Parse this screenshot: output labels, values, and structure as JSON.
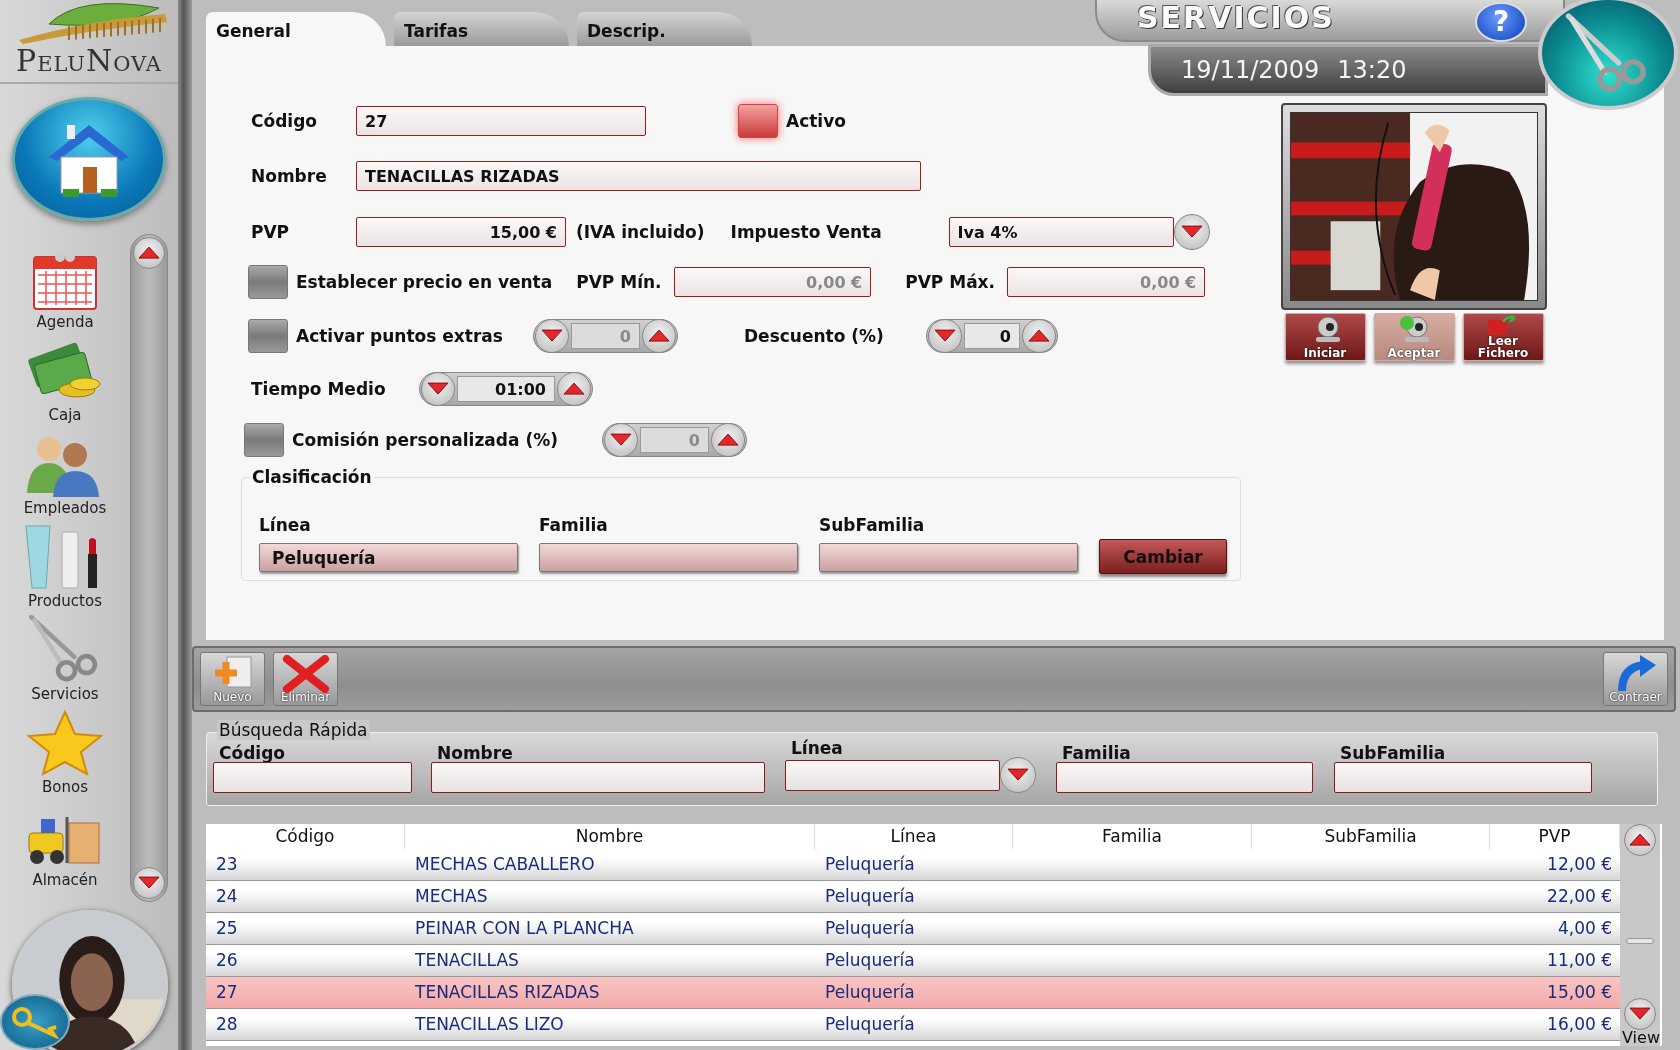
{
  "sidebar": {
    "logo": "PeluNova",
    "nav": [
      {
        "label": "Agenda"
      },
      {
        "label": "Caja"
      },
      {
        "label": "Empleados"
      },
      {
        "label": "Productos"
      },
      {
        "label": "Servicios"
      },
      {
        "label": "Bonos"
      },
      {
        "label": "Almacén"
      }
    ]
  },
  "tabs": [
    {
      "label": "General",
      "selected": true
    },
    {
      "label": "Tarifas",
      "selected": false
    },
    {
      "label": "Descrip.",
      "selected": false
    }
  ],
  "header": {
    "title": "SERVICIOS",
    "help": "?",
    "date": "19/11/2009",
    "time": "13:20"
  },
  "form": {
    "codigo": {
      "label": "Código",
      "value": "27"
    },
    "activo": {
      "label": "Activo",
      "checked": true
    },
    "nombre": {
      "label": "Nombre",
      "value": "TENACILLAS RIZADAS"
    },
    "pvp": {
      "label": "PVP",
      "value": "15,00 €",
      "note": "(IVA incluido)"
    },
    "impuesto": {
      "label": "Impuesto Venta",
      "value": "Iva 4%"
    },
    "establecer": {
      "label": "Establecer precio en venta",
      "checked": false
    },
    "pvp_min": {
      "label": "PVP Mín.",
      "value": "0,00 €",
      "disabled": true
    },
    "pvp_max": {
      "label": "PVP Máx.",
      "value": "0,00 €",
      "disabled": true
    },
    "puntos": {
      "label": "Activar puntos extras",
      "checked": false,
      "value": "0",
      "disabled": true
    },
    "descuento": {
      "label": "Descuento (%)",
      "value": "0",
      "disabled": false
    },
    "tiempo": {
      "label": "Tiempo Medio",
      "value": "01:00",
      "disabled": false
    },
    "comision": {
      "label": "Comisión personalizada (%)",
      "checked": false,
      "value": "0",
      "disabled": true
    },
    "clasificacion": {
      "title": "Clasificación",
      "fields": [
        {
          "label": "Línea",
          "value": "Peluquería"
        },
        {
          "label": "Familia"
        },
        {
          "label": "SubFamilia"
        }
      ],
      "button": "Cambiar"
    }
  },
  "photo": {
    "kind": "picture",
    "buttons": [
      {
        "label": "Iniciar",
        "disabled": false
      },
      {
        "label": "Aceptar",
        "disabled": true
      },
      {
        "label": "Leer Fichero",
        "disabled": false
      }
    ]
  },
  "toolbar": {
    "buttons": [
      {
        "label": "Nuevo"
      },
      {
        "label": "Eliminar"
      }
    ],
    "collapse": "Contraer"
  },
  "search": {
    "title": "Búsqueda Rápida",
    "fields": [
      {
        "label": "Código",
        "kind": "text"
      },
      {
        "label": "Nombre",
        "kind": "text"
      },
      {
        "label": "Línea",
        "kind": "dropdown"
      },
      {
        "label": "Familia",
        "kind": "text"
      },
      {
        "label": "SubFamilia",
        "kind": "text"
      }
    ]
  },
  "table": {
    "columns": [
      "Código",
      "Nombre",
      "Línea",
      "Familia",
      "SubFamilia",
      "PVP"
    ],
    "rows": [
      {
        "cells": [
          "23",
          "MECHAS CABALLERO",
          "Peluquería",
          "",
          "",
          "12,00 €"
        ],
        "selected": false
      },
      {
        "cells": [
          "24",
          "MECHAS",
          "Peluquería",
          "",
          "",
          "22,00 €"
        ],
        "selected": false
      },
      {
        "cells": [
          "25",
          "PEINAR CON LA PLANCHA",
          "Peluquería",
          "",
          "",
          "4,00 €"
        ],
        "selected": false
      },
      {
        "cells": [
          "26",
          "TENACILLAS",
          "Peluquería",
          "",
          "",
          "11,00 €"
        ],
        "selected": false
      },
      {
        "cells": [
          "27",
          "TENACILLAS RIZADAS",
          "Peluquería",
          "",
          "",
          "15,00 €"
        ],
        "selected": true
      },
      {
        "cells": [
          "28",
          "TENACILLAS LIZO",
          "Peluquería",
          "",
          "",
          "16,00 €"
        ],
        "selected": false
      }
    ],
    "footer": "View"
  }
}
